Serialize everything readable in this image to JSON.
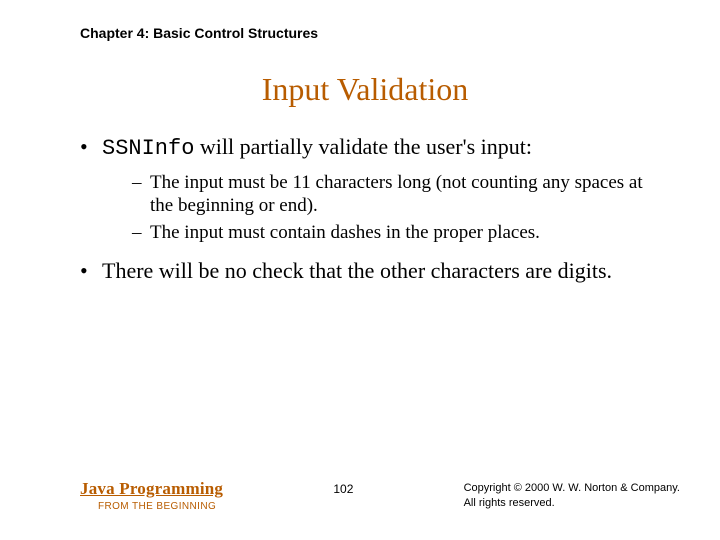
{
  "header": {
    "chapter": "Chapter 4: Basic Control Structures"
  },
  "title": "Input Validation",
  "bullets": [
    {
      "prefix_code": "SSNInfo",
      "rest": " will partially validate the user's input:",
      "subs": [
        "The input must be 11 characters long (not counting any spaces at the beginning or end).",
        "The input must contain dashes in the proper places."
      ]
    },
    {
      "text": "There will be no check that the other characters are digits."
    }
  ],
  "footer": {
    "book_title": "Java Programming",
    "book_subtitle": "FROM THE BEGINNING",
    "page": "102",
    "copyright_line1": "Copyright © 2000 W. W. Norton & Company.",
    "copyright_line2": "All rights reserved."
  }
}
